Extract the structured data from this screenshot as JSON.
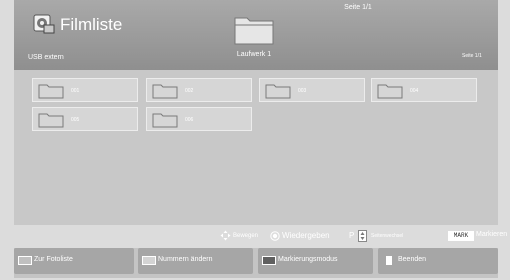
{
  "header": {
    "title": "Filmliste",
    "page_indicator": "Seite 1/1",
    "drive_label": "Laufwerk 1",
    "source_label": "USB extern",
    "page_indicator_right": "Seite 1/1",
    "app_icon": "film-icon",
    "drive_icon": "folder-icon"
  },
  "folders": [
    {
      "label": "001"
    },
    {
      "label": "002"
    },
    {
      "label": "003"
    },
    {
      "label": "004"
    },
    {
      "label": "005"
    },
    {
      "label": "006"
    }
  ],
  "hints": {
    "move_icon": "arrows-icon",
    "move": "Bewegen",
    "play_icon": "ok-button-icon",
    "play": "Wiedergeben",
    "p_key": "P",
    "page_icon": "page-arrows-icon",
    "page_change": "Seitenwechsel",
    "mark_key": "MARK",
    "mark": "Markieren"
  },
  "buttons": [
    {
      "label": "Zur Fotoliste",
      "color": "#c0c0c0"
    },
    {
      "label": "Nummern ändern",
      "color": "#d4d4d4"
    },
    {
      "label": "Markierungsmodus",
      "color": "#606060"
    },
    {
      "label": "Beenden",
      "color": "#ffffff"
    }
  ]
}
